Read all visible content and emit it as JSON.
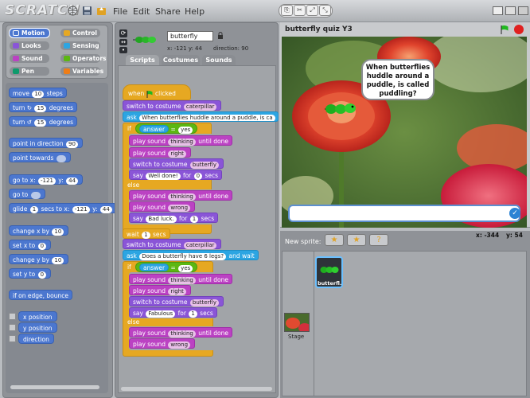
{
  "app": {
    "logo": "SCRATCH"
  },
  "menu": {
    "file": "File",
    "edit": "Edit",
    "share": "Share",
    "help": "Help"
  },
  "categories": {
    "motion": "Motion",
    "control": "Control",
    "looks": "Looks",
    "sensing": "Sensing",
    "sound": "Sound",
    "operators": "Operators",
    "pen": "Pen",
    "variables": "Variables"
  },
  "palette": {
    "move": "move",
    "move_val": "10",
    "move_tail": "steps",
    "turn_cw": "turn",
    "turn_cw_val": "15",
    "turn_cw_tail": "degrees",
    "turn_ccw": "turn",
    "turn_ccw_val": "15",
    "turn_ccw_tail": "degrees",
    "point_dir": "point in direction",
    "point_dir_val": "90",
    "point_towards": "point towards",
    "goto_xy": "go to x:",
    "goto_x": "-121",
    "goto_y_label": "y:",
    "goto_y": "44",
    "goto": "go to",
    "glide": "glide",
    "glide_val": "1",
    "glide_mid": "secs to x:",
    "glide_x": "-121",
    "glide_y_label": "y:",
    "glide_y": "44",
    "change_x": "change x by",
    "change_x_val": "10",
    "set_x": "set x to",
    "set_x_val": "0",
    "change_y": "change y by",
    "change_y_val": "10",
    "set_y": "set y to",
    "set_y_val": "0",
    "bounce": "if on edge, bounce",
    "x_position": "x position",
    "y_position": "y position",
    "direction": "direction"
  },
  "sprite": {
    "name": "butterfly",
    "coords": "x: -121  y: 44",
    "direction": "direction: 90"
  },
  "tabs": {
    "scripts": "Scripts",
    "costumes": "Costumes",
    "sounds": "Sounds"
  },
  "script": {
    "when_clicked": "when",
    "when_clicked_tail": "clicked",
    "switch_costume": "switch to costume",
    "costume_caterpillar": "caterpillar",
    "ask1": "ask",
    "ask1_text": "When butterflies huddle around a puddle, is ca",
    "if": "if",
    "answer": "answer",
    "eq": "=",
    "yes": "yes",
    "play_sound": "play sound",
    "until_done": "until done",
    "thinking": "thinking",
    "right": "right",
    "costume_butterfly": "butterfly",
    "say": "say",
    "well_done": "Well done!",
    "for": "for",
    "zero": "0",
    "secs": "secs",
    "else": "else",
    "wrong": "wrong",
    "bad_luck": "Bad luck.",
    "one": "1",
    "wait": "wait",
    "wait_val": "1",
    "wait_tail": "secs",
    "ask2_text": "Does a butterfly have 6 legs?",
    "and_wait": "and wait",
    "fabulous": "Fabulous"
  },
  "stage": {
    "title": "butterfly quiz Y3",
    "speech": "When butterflies huddle around a puddle, is called puddling?",
    "answer_placeholder": ""
  },
  "new_sprite": {
    "label": "New sprite:"
  },
  "mouse": {
    "x": "x: -344",
    "y": "y: 54"
  },
  "sprites": [
    {
      "name": "butterfl..."
    }
  ],
  "stage_item": {
    "label": "Stage"
  },
  "colors": {
    "motion": "#4c77cf",
    "looks": "#8a55d7",
    "sound": "#bb42c3",
    "pen": "#0e9a6c",
    "control": "#e6a822",
    "sensing": "#2ca5e2",
    "operators": "#5cb712",
    "variables": "#ee7d16"
  }
}
